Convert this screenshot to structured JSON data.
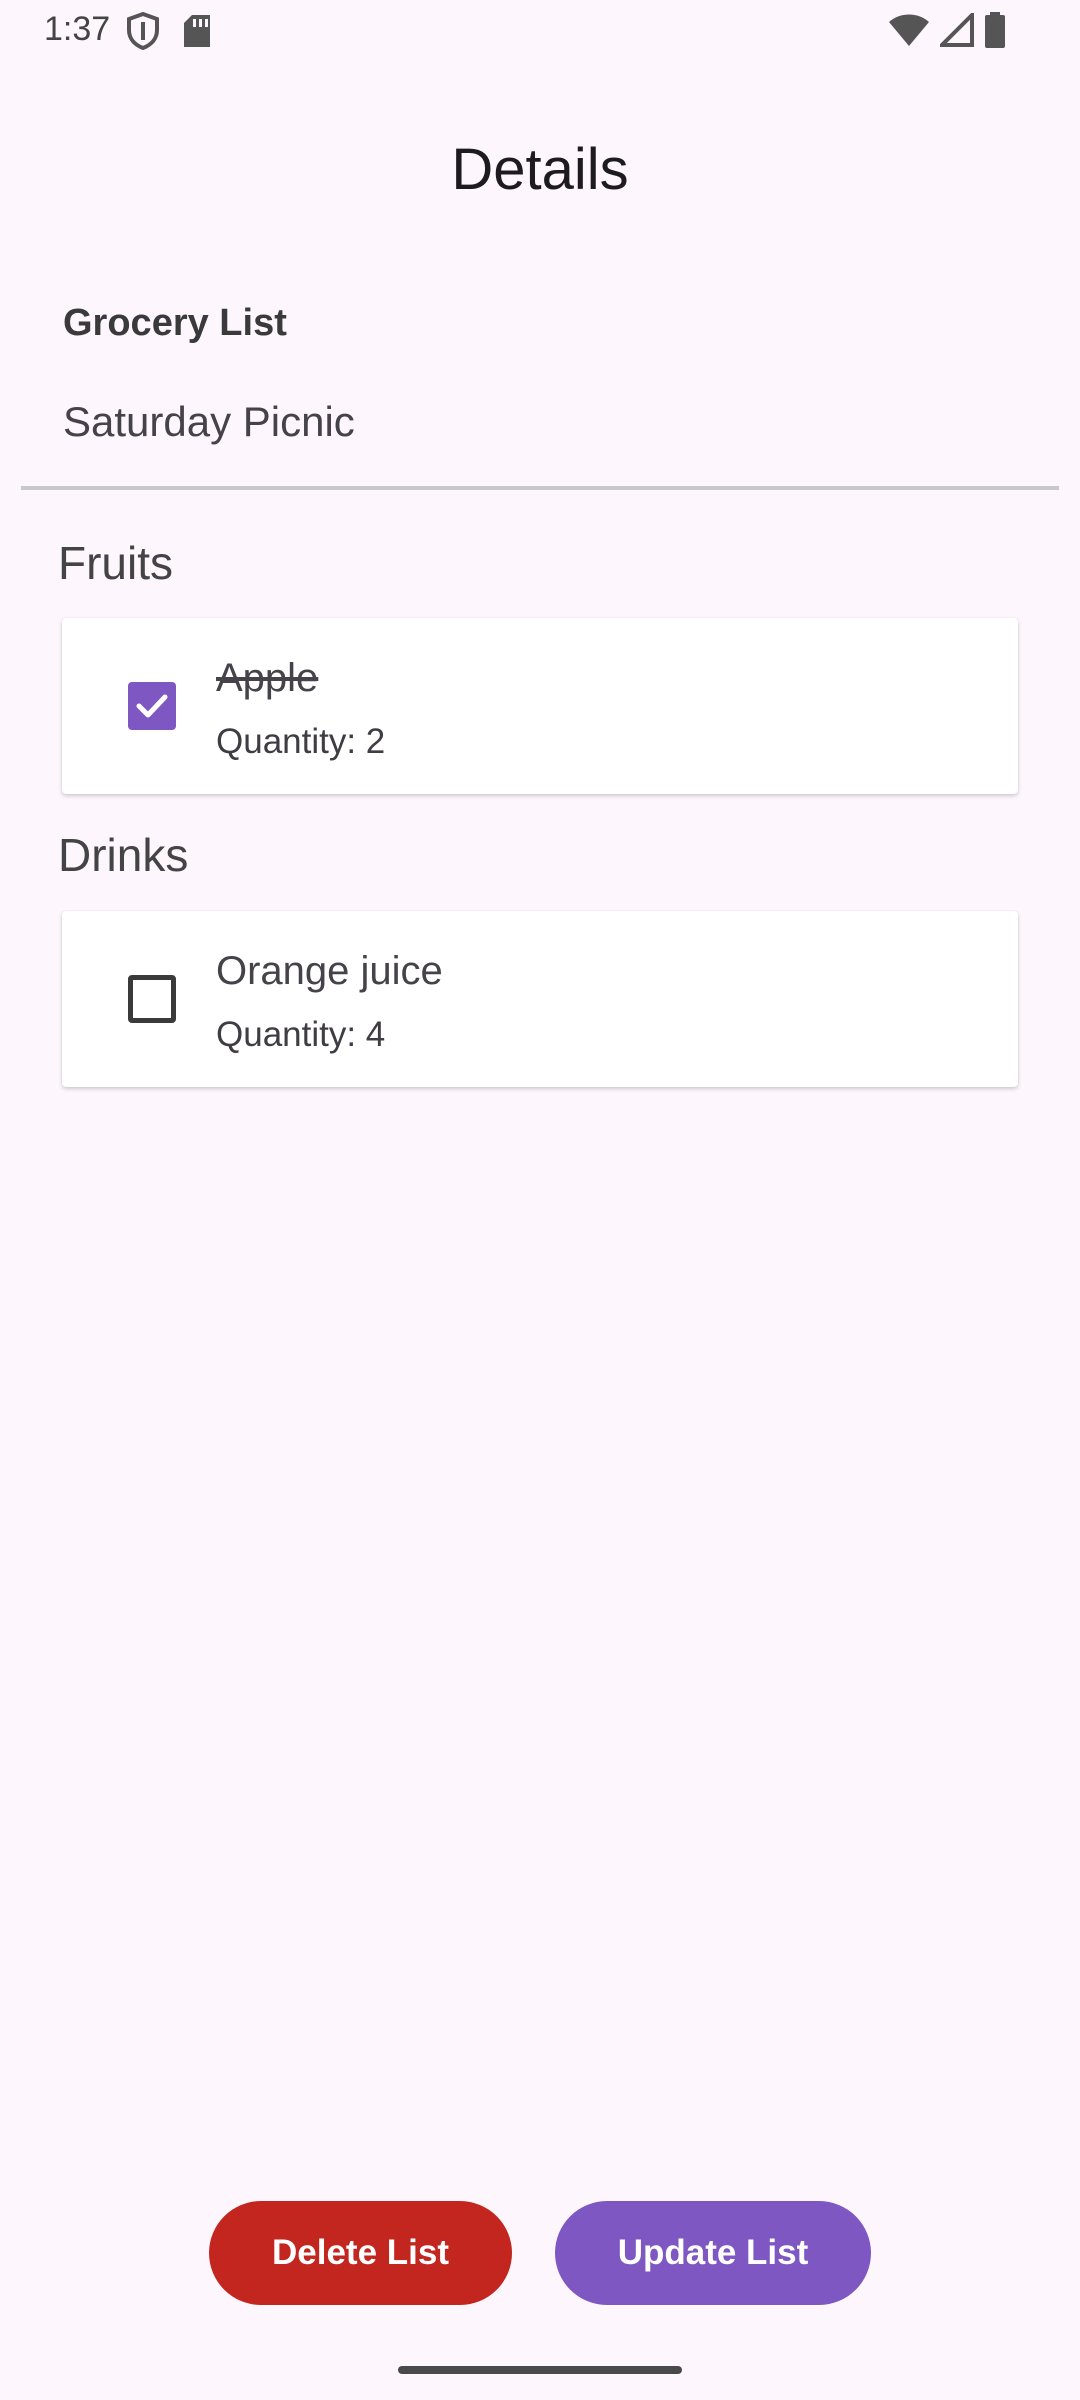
{
  "status_bar": {
    "time": "1:37",
    "icons": [
      "shield-icon",
      "sd-card-icon",
      "wifi-icon",
      "signal-icon",
      "battery-icon"
    ]
  },
  "screen": {
    "title": "Details"
  },
  "list_field": {
    "label": "Grocery List",
    "value": "Saturday Picnic"
  },
  "categories": [
    {
      "name": "Fruits",
      "items": [
        {
          "name": "Apple",
          "quantity_text": "Quantity: 2",
          "checked": true
        }
      ]
    },
    {
      "name": "Drinks",
      "items": [
        {
          "name": "Orange juice",
          "quantity_text": "Quantity: 4",
          "checked": false
        }
      ]
    }
  ],
  "actions": {
    "delete_label": "Delete List",
    "update_label": "Update List"
  },
  "colors": {
    "accent": "#7e57c2",
    "danger": "#c3261f",
    "background": "#fdf7fd"
  }
}
